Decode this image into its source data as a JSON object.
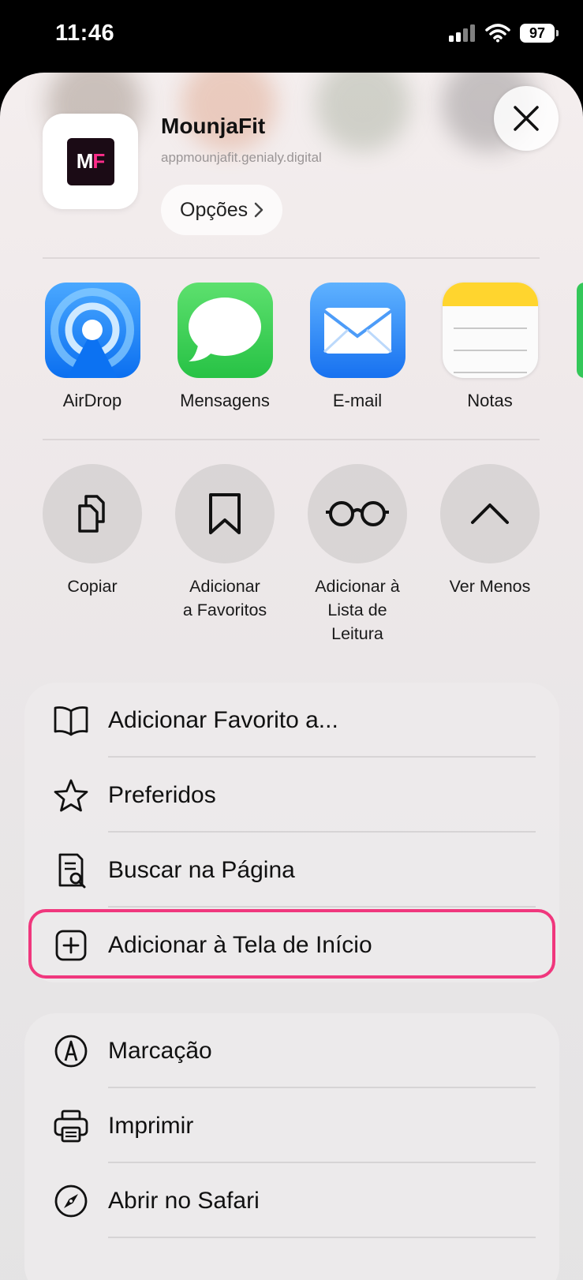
{
  "status_bar": {
    "time": "11:46",
    "battery": "97"
  },
  "share_header": {
    "title": "MounjaFit",
    "url": "appmounjafit.genialy.digital",
    "options_label": "Opções",
    "logo_text_m": "M",
    "logo_text_f": "F"
  },
  "apps": [
    {
      "label": "AirDrop",
      "icon": "airdrop-icon"
    },
    {
      "label": "Mensagens",
      "icon": "messages-icon"
    },
    {
      "label": "E-mail",
      "icon": "mail-icon"
    },
    {
      "label": "Notas",
      "icon": "notes-icon"
    }
  ],
  "actions": [
    {
      "label": "Copiar",
      "icon": "copy-icon"
    },
    {
      "label": "Adicionar\na Favoritos",
      "icon": "bookmark-icon"
    },
    {
      "label": "Adicionar à\nLista de\nLeitura",
      "icon": "glasses-icon"
    },
    {
      "label": "Ver Menos",
      "icon": "chevron-up-icon"
    }
  ],
  "menu_group_1": [
    {
      "label": "Adicionar Favorito a...",
      "icon": "book-icon"
    },
    {
      "label": "Preferidos",
      "icon": "star-icon"
    },
    {
      "label": "Buscar na Página",
      "icon": "find-on-page-icon"
    },
    {
      "label": "Adicionar à Tela de Início",
      "icon": "add-square-icon"
    }
  ],
  "menu_group_2": [
    {
      "label": "Marcação",
      "icon": "markup-icon"
    },
    {
      "label": "Imprimir",
      "icon": "printer-icon"
    },
    {
      "label": "Abrir no Safari",
      "icon": "compass-icon"
    }
  ],
  "colors": {
    "highlight": "#f0377d",
    "airdrop": "#1a8cff",
    "messages": "#34c759",
    "mail": "#2f8cff",
    "notes_top": "#ffd52e"
  }
}
